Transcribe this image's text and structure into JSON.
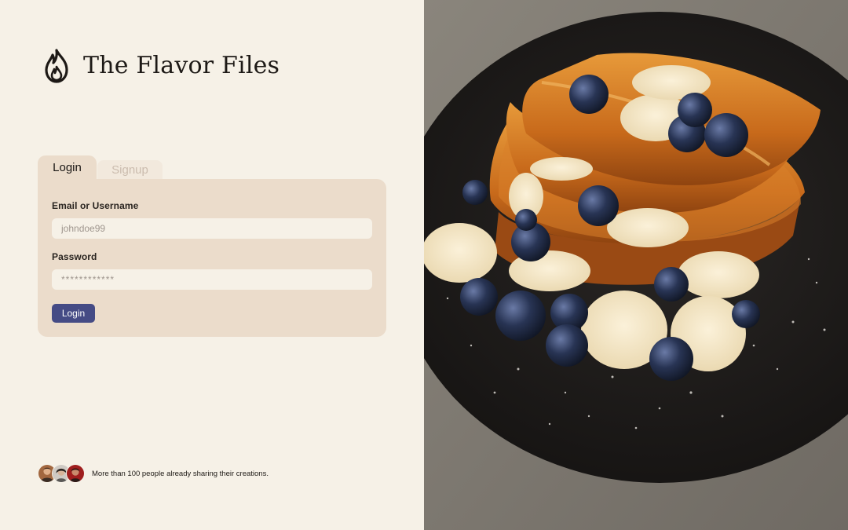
{
  "brand": {
    "name": "The Flavor Files",
    "logo_icon": "flame-icon"
  },
  "tabs": [
    {
      "label": "Login",
      "active": true
    },
    {
      "label": "Signup",
      "active": false
    }
  ],
  "form": {
    "email_label": "Email or Username",
    "email_placeholder": "johndoe99",
    "password_label": "Password",
    "password_placeholder": "************",
    "submit_label": "Login"
  },
  "social_proof": {
    "text": "More than 100 people already sharing their creations.",
    "avatars": [
      "avatar-1",
      "avatar-2",
      "avatar-3"
    ]
  },
  "hero_image": {
    "subject": "french-toast-with-bananas-and-blueberries"
  },
  "colors": {
    "background": "#f6f1e7",
    "card": "#ebdccb",
    "input": "#f6f1e7",
    "button": "#454b85",
    "text": "#1f1b17"
  }
}
